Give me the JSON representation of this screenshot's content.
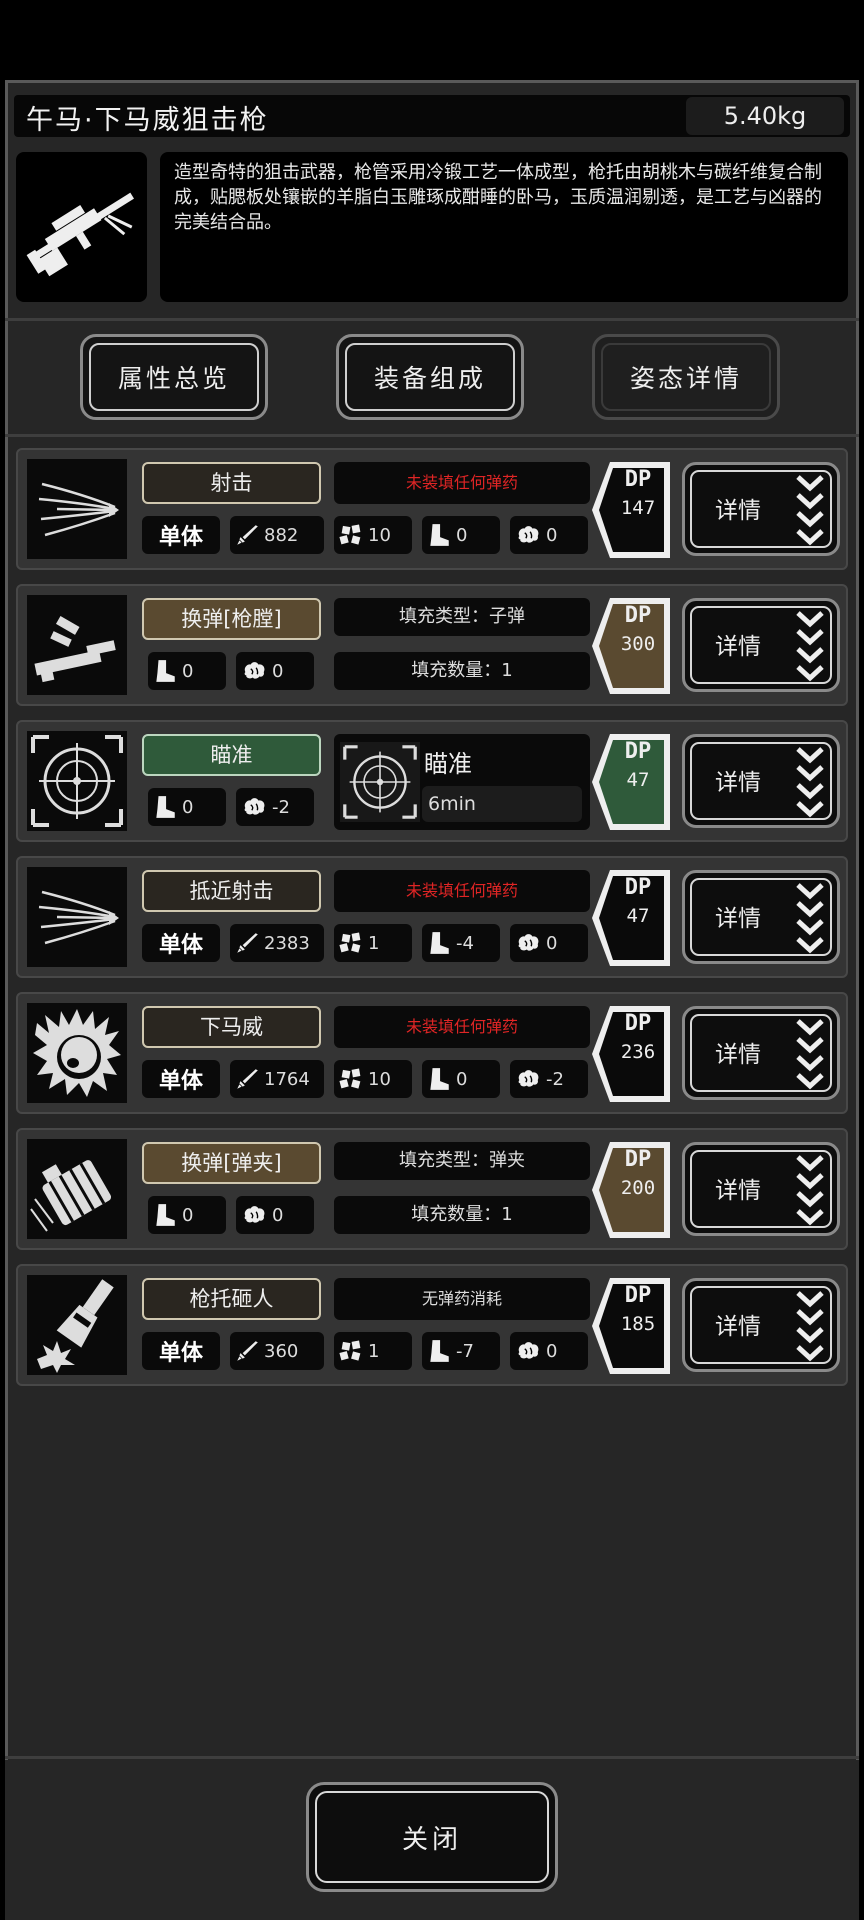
{
  "item": {
    "name": "午马·下马威狙击枪",
    "weight": "5.40kg",
    "description": "造型奇特的狙击武器，枪管采用冷锻工艺一体成型，枪托由胡桃木与碳纤维复合制成，贴腮板处镶嵌的羊脂白玉雕琢成酣睡的卧马，玉质温润剔透，是工艺与凶器的完美结合品。"
  },
  "tabs": [
    {
      "label": "属性总览"
    },
    {
      "label": "装备组成"
    },
    {
      "label": "姿态详情"
    }
  ],
  "detail_label": "详情",
  "single_label": "单体",
  "actions": [
    {
      "name": "射击",
      "warn": "未装填任何弹药",
      "target": "单体",
      "attack": "882",
      "hit": "10",
      "move": "0",
      "brain": "0",
      "dp_label": "DP",
      "dp": "147"
    },
    {
      "name": "换弹[枪膛]",
      "fill_type": "填充类型：子弹",
      "fill_count": "填充数量：1",
      "move": "0",
      "brain": "0",
      "dp_label": "DP",
      "dp": "300"
    },
    {
      "name": "瞄准",
      "aim_title": "瞄准",
      "aim_time": "6min",
      "move": "0",
      "brain": "-2",
      "dp_label": "DP",
      "dp": "47"
    },
    {
      "name": "抵近射击",
      "warn": "未装填任何弹药",
      "target": "单体",
      "attack": "2383",
      "hit": "1",
      "move": "-4",
      "brain": "0",
      "dp_label": "DP",
      "dp": "47"
    },
    {
      "name": "下马威",
      "warn": "未装填任何弹药",
      "target": "单体",
      "attack": "1764",
      "hit": "10",
      "move": "0",
      "brain": "-2",
      "dp_label": "DP",
      "dp": "236"
    },
    {
      "name": "换弹[弹夹]",
      "fill_type": "填充类型：弹夹",
      "fill_count": "填充数量：1",
      "move": "0",
      "brain": "0",
      "dp_label": "DP",
      "dp": "200"
    },
    {
      "name": "枪托砸人",
      "warn": "无弹药消耗",
      "target": "单体",
      "attack": "360",
      "hit": "1",
      "move": "-7",
      "brain": "0",
      "dp_label": "DP",
      "dp": "185"
    }
  ],
  "close_label": "关闭",
  "colors": {
    "warn": "#e02525",
    "dp_gold": "#5a4a30",
    "dp_green": "#2f5a3a"
  }
}
